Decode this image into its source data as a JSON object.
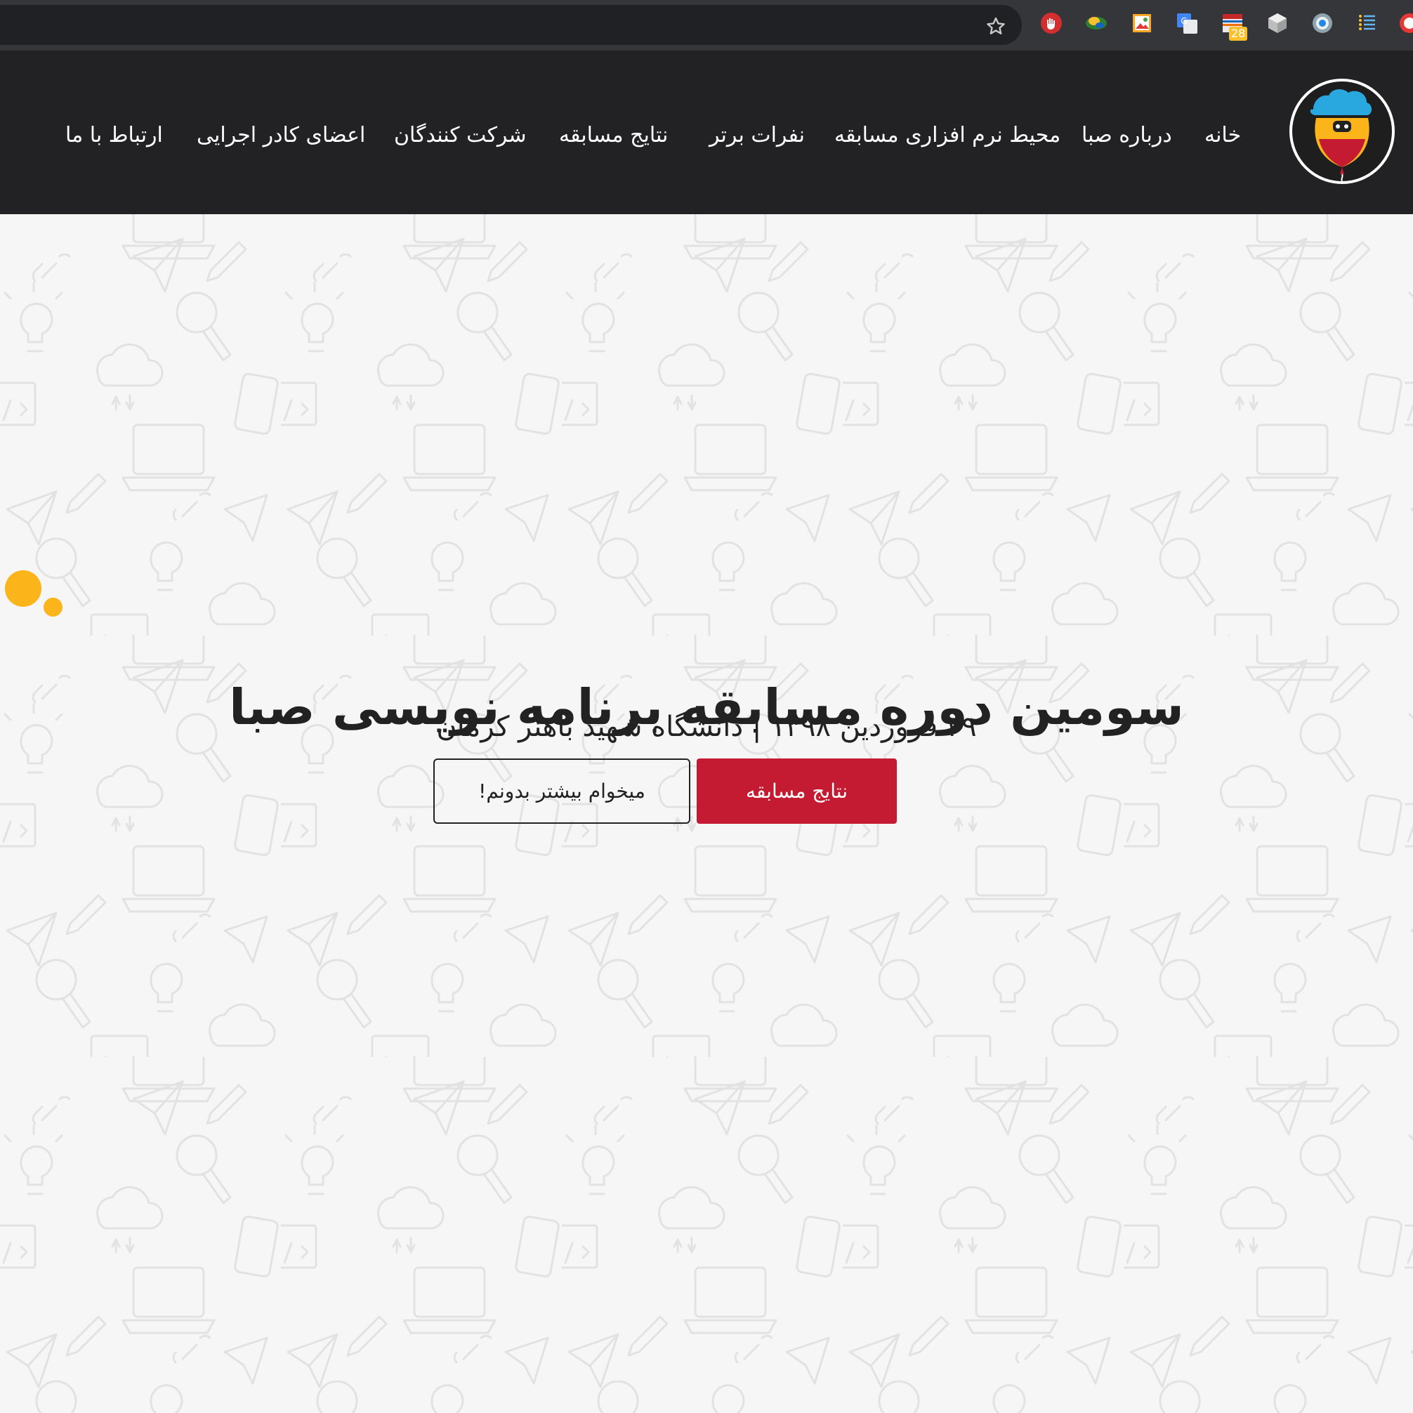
{
  "browser": {
    "toolbar_badge": "28",
    "extensions": [
      "ublock-icon",
      "earth-icon",
      "image-picker-icon",
      "google-translate-icon",
      "calendar-icon",
      "cube-icon",
      "circle-extension-icon",
      "menu-list-icon"
    ]
  },
  "nav": {
    "items": [
      {
        "label": "خانه"
      },
      {
        "label": "درباره صبا"
      },
      {
        "label": "محیط نرم افزاری مسابقه"
      },
      {
        "label": "نفرات برتر"
      },
      {
        "label": "نتایج مسابقه"
      },
      {
        "label": "شرکت کنندگان"
      },
      {
        "label": "اعضای کادر اجرایی"
      },
      {
        "label": "ارتباط با ما"
      }
    ]
  },
  "hero": {
    "title": "سومین دوره مسابقه برنامه نویسی صبا",
    "subtitle": "۲۹ فروردین ۱۳۹۸ | دانشگاه شهید باهنر کرمان",
    "primary_button": "نتایج مسابقه",
    "secondary_button": "میخوام بیشتر بدونم!"
  },
  "colors": {
    "nav_bg": "#222225",
    "accent_red": "#c41b32",
    "accent_yellow": "#fbb51b",
    "page_bg": "#f6f6f6"
  }
}
